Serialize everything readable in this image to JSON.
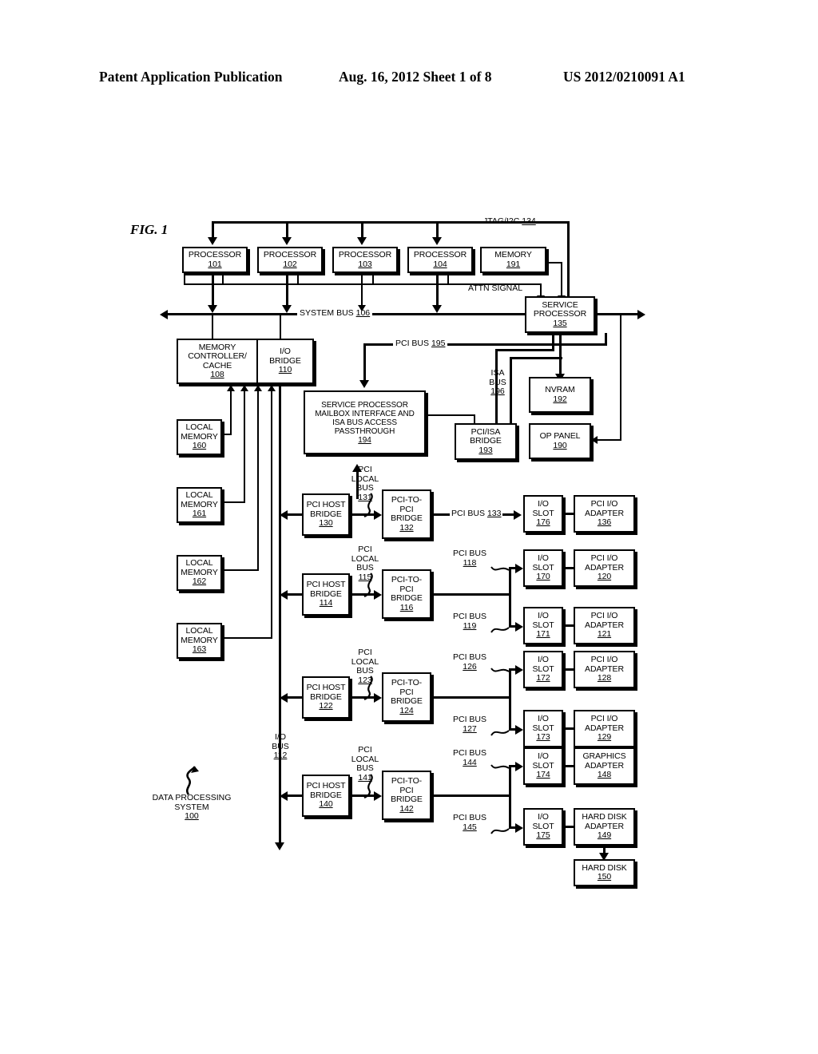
{
  "header": {
    "publication": "Patent Application Publication",
    "date_sheet": "Aug. 16, 2012  Sheet 1 of 8",
    "patent_number": "US 2012/0210091 A1"
  },
  "figure": {
    "label": "FIG. 1",
    "system_label_line1": "DATA PROCESSING",
    "system_label_line2": "SYSTEM",
    "system_ref": "100"
  },
  "processors": [
    {
      "name": "PROCESSOR",
      "ref": "101"
    },
    {
      "name": "PROCESSOR",
      "ref": "102"
    },
    {
      "name": "PROCESSOR",
      "ref": "103"
    },
    {
      "name": "PROCESSOR",
      "ref": "104"
    }
  ],
  "memory_191": {
    "name": "MEMORY",
    "ref": "191"
  },
  "service_processor": {
    "line1": "SERVICE",
    "line2": "PROCESSOR",
    "ref": "135"
  },
  "buses": {
    "jtag": {
      "name": "JTAG/I2C",
      "ref": "134"
    },
    "attn": {
      "name": "ATTN SIGNAL"
    },
    "system_bus": {
      "name": "SYSTEM BUS",
      "ref": "106"
    },
    "pci_bus_195": {
      "name": "PCI BUS",
      "ref": "195"
    },
    "isa_bus": {
      "line1": "ISA",
      "line2": "BUS",
      "ref": "196"
    },
    "io_bus": {
      "line1": "I/O",
      "line2": "BUS",
      "ref": "112"
    }
  },
  "memory_controller": {
    "line1": "MEMORY",
    "line2": "CONTROLLER/",
    "line3": "CACHE",
    "ref": "108"
  },
  "io_bridge": {
    "line1": "I/O",
    "line2": "BRIDGE",
    "ref": "110"
  },
  "mailbox": {
    "line1": "SERVICE PROCESSOR",
    "line2": "MAILBOX INTERFACE AND",
    "line3": "ISA BUS ACCESS",
    "line4": "PASSTHROUGH",
    "ref": "194"
  },
  "pci_isa_bridge": {
    "line1": "PCI/ISA",
    "line2": "BRIDGE",
    "ref": "193"
  },
  "nvram": {
    "name": "NVRAM",
    "ref": "192"
  },
  "op_panel": {
    "name": "OP PANEL",
    "ref": "190"
  },
  "local_memories": [
    {
      "line1": "LOCAL",
      "line2": "MEMORY",
      "ref": "160"
    },
    {
      "line1": "LOCAL",
      "line2": "MEMORY",
      "ref": "161"
    },
    {
      "line1": "LOCAL",
      "line2": "MEMORY",
      "ref": "162"
    },
    {
      "line1": "LOCAL",
      "line2": "MEMORY",
      "ref": "163"
    }
  ],
  "pci_rows": [
    {
      "host_bridge": {
        "line1": "PCI HOST",
        "line2": "BRIDGE",
        "ref": "130"
      },
      "local_bus": {
        "line1": "PCI",
        "line2": "LOCAL",
        "line3": "BUS",
        "ref": "131"
      },
      "ptp_bridge": {
        "line1": "PCI-TO-",
        "line2": "PCI",
        "line3": "BRIDGE",
        "ref": "132"
      },
      "slots": [
        {
          "bus": {
            "name": "PCI BUS",
            "ref": "133"
          },
          "slot": {
            "line1": "I/O",
            "line2": "SLOT",
            "ref": "176"
          },
          "adapter": {
            "line1": "PCI I/O",
            "line2": "ADAPTER",
            "ref": "136"
          }
        }
      ]
    },
    {
      "host_bridge": {
        "line1": "PCI HOST",
        "line2": "BRIDGE",
        "ref": "114"
      },
      "local_bus": {
        "line1": "PCI",
        "line2": "LOCAL",
        "line3": "BUS",
        "ref": "115"
      },
      "ptp_bridge": {
        "line1": "PCI-TO-",
        "line2": "PCI",
        "line3": "BRIDGE",
        "ref": "116"
      },
      "slots": [
        {
          "bus": {
            "name": "PCI BUS",
            "ref": "118"
          },
          "slot": {
            "line1": "I/O",
            "line2": "SLOT",
            "ref": "170"
          },
          "adapter": {
            "line1": "PCI I/O",
            "line2": "ADAPTER",
            "ref": "120"
          }
        },
        {
          "bus": {
            "name": "PCI BUS",
            "ref": "119"
          },
          "slot": {
            "line1": "I/O",
            "line2": "SLOT",
            "ref": "171"
          },
          "adapter": {
            "line1": "PCI I/O",
            "line2": "ADAPTER",
            "ref": "121"
          }
        }
      ]
    },
    {
      "host_bridge": {
        "line1": "PCI HOST",
        "line2": "BRIDGE",
        "ref": "122"
      },
      "local_bus": {
        "line1": "PCI",
        "line2": "LOCAL",
        "line3": "BUS",
        "ref": "123"
      },
      "ptp_bridge": {
        "line1": "PCI-TO-",
        "line2": "PCI",
        "line3": "BRIDGE",
        "ref": "124"
      },
      "slots": [
        {
          "bus": {
            "name": "PCI BUS",
            "ref": "126"
          },
          "slot": {
            "line1": "I/O",
            "line2": "SLOT",
            "ref": "172"
          },
          "adapter": {
            "line1": "PCI I/O",
            "line2": "ADAPTER",
            "ref": "128"
          }
        },
        {
          "bus": {
            "name": "PCI BUS",
            "ref": "127"
          },
          "slot": {
            "line1": "I/O",
            "line2": "SLOT",
            "ref": "173"
          },
          "adapter": {
            "line1": "PCI I/O",
            "line2": "ADAPTER",
            "ref": "129"
          }
        }
      ]
    },
    {
      "host_bridge": {
        "line1": "PCI HOST",
        "line2": "BRIDGE",
        "ref": "140"
      },
      "local_bus": {
        "line1": "PCI",
        "line2": "LOCAL",
        "line3": "BUS",
        "ref": "141"
      },
      "ptp_bridge": {
        "line1": "PCI-TO-",
        "line2": "PCI",
        "line3": "BRIDGE",
        "ref": "142"
      },
      "slots": [
        {
          "bus": {
            "name": "PCI BUS",
            "ref": "144"
          },
          "slot": {
            "line1": "I/O",
            "line2": "SLOT",
            "ref": "174"
          },
          "adapter": {
            "line1": "GRAPHICS",
            "line2": "ADAPTER",
            "ref": "148"
          }
        },
        {
          "bus": {
            "name": "PCI BUS",
            "ref": "145"
          },
          "slot": {
            "line1": "I/O",
            "line2": "SLOT",
            "ref": "175"
          },
          "adapter": {
            "line1": "HARD DISK",
            "line2": "ADAPTER",
            "ref": "149"
          }
        }
      ]
    }
  ],
  "hard_disk": {
    "name": "HARD DISK",
    "ref": "150"
  }
}
